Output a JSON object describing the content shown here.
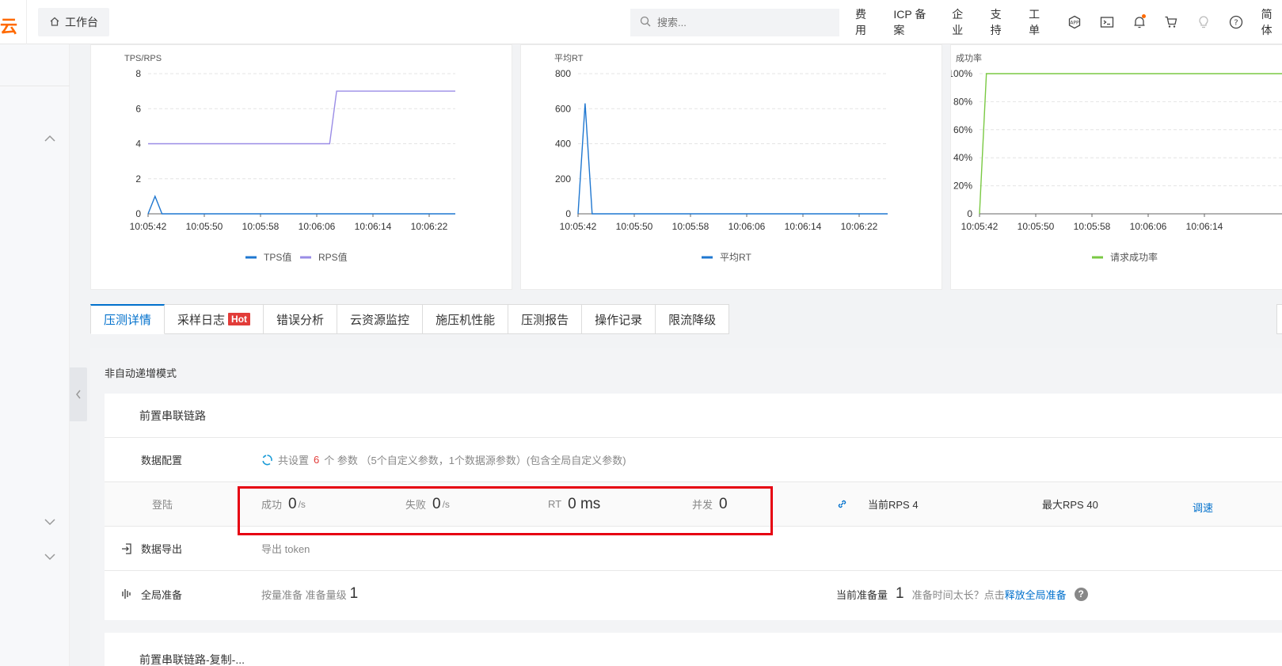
{
  "topbar": {
    "logo_text": "云",
    "workbench_label": "工作台",
    "search_placeholder": "搜索...",
    "nav_items": [
      "费用",
      "ICP 备案",
      "企业",
      "支持",
      "工单"
    ],
    "lang_label": "简体",
    "accent_color": "#ff6a00"
  },
  "charts": {
    "tps": {
      "title": "TPS/RPS",
      "legend": [
        "TPS值",
        "RPS值"
      ]
    },
    "rt": {
      "title": "平均RT",
      "legend": [
        "平均RT"
      ]
    },
    "success": {
      "title": "成功率",
      "legend": [
        "请求成功率"
      ]
    }
  },
  "chart_data": [
    {
      "type": "line",
      "title": "TPS/RPS",
      "x_ticks": [
        "10:05:42",
        "10:05:50",
        "10:05:58",
        "10:06:06",
        "10:06:14",
        "10:06:22"
      ],
      "y_ticks": [
        "0",
        "2",
        "4",
        "6",
        "8"
      ],
      "ylim": [
        0,
        8
      ],
      "series": [
        {
          "name": "TPS值",
          "color": "#1f77d0",
          "points": [
            [
              0,
              0
            ],
            [
              1,
              1
            ],
            [
              2,
              0
            ],
            [
              44,
              0
            ]
          ]
        },
        {
          "name": "RPS值",
          "color": "#9a8ce6",
          "points": [
            [
              0,
              4
            ],
            [
              26,
              4
            ],
            [
              27,
              7
            ],
            [
              44,
              7
            ]
          ]
        }
      ]
    },
    {
      "type": "line",
      "title": "平均RT",
      "x_ticks": [
        "10:05:42",
        "10:05:50",
        "10:05:58",
        "10:06:06",
        "10:06:14",
        "10:06:22"
      ],
      "y_ticks": [
        "0",
        "200",
        "400",
        "600",
        "800"
      ],
      "ylim": [
        0,
        800
      ],
      "series": [
        {
          "name": "平均RT",
          "color": "#1f77d0",
          "points": [
            [
              0,
              0
            ],
            [
              1,
              630
            ],
            [
              2,
              0
            ],
            [
              44,
              0
            ]
          ]
        }
      ]
    },
    {
      "type": "line",
      "title": "成功率",
      "x_ticks": [
        "10:05:42",
        "10:05:50",
        "10:05:58",
        "10:06:06",
        "10:06:14"
      ],
      "y_ticks": [
        "0",
        "20%",
        "40%",
        "60%",
        "80%",
        "100%"
      ],
      "ylim": [
        0,
        100
      ],
      "series": [
        {
          "name": "请求成功率",
          "color": "#7ac943",
          "points": [
            [
              0,
              0
            ],
            [
              1,
              100
            ],
            [
              44,
              100
            ]
          ]
        }
      ]
    }
  ],
  "tabs": [
    {
      "label": "压测详情",
      "active": true
    },
    {
      "label": "采样日志",
      "badge": "Hot"
    },
    {
      "label": "错误分析"
    },
    {
      "label": "云资源监控"
    },
    {
      "label": "施压机性能"
    },
    {
      "label": "压测报告"
    },
    {
      "label": "操作记录"
    },
    {
      "label": "限流降级"
    }
  ],
  "detail": {
    "mode": "非自动递增模式",
    "chain_title": "前置串联链路",
    "data_config_label": "数据配置",
    "data_config_text_prefix": "共设置",
    "data_config_count": "6",
    "data_config_text_suffix": "个 参数 （5个自定义参数，1个数据源参数）(包含全局自定义参数)",
    "api_name": "登陆",
    "success_label": "成功",
    "success_value": "0",
    "success_unit": "/s",
    "fail_label": "失败",
    "fail_value": "0",
    "fail_unit": "/s",
    "rt_label": "RT",
    "rt_value": "0 ms",
    "concurrency_label": "并发",
    "concurrency_value": "0",
    "current_rps": "当前RPS 4",
    "max_rps": "最大RPS 40",
    "adjust_label": "调速",
    "export_label": "数据导出",
    "export_text": "导出 token",
    "global_prep_label": "全局准备",
    "prep_text": "按量准备 准备量级",
    "prep_value": "1",
    "current_prep_label": "当前准备量",
    "current_prep_value": "1",
    "prep_hint": "准备时间太长？点击",
    "release_label": "释放全局准备",
    "chain_copy_title": "前置串联链路-复制-..."
  }
}
